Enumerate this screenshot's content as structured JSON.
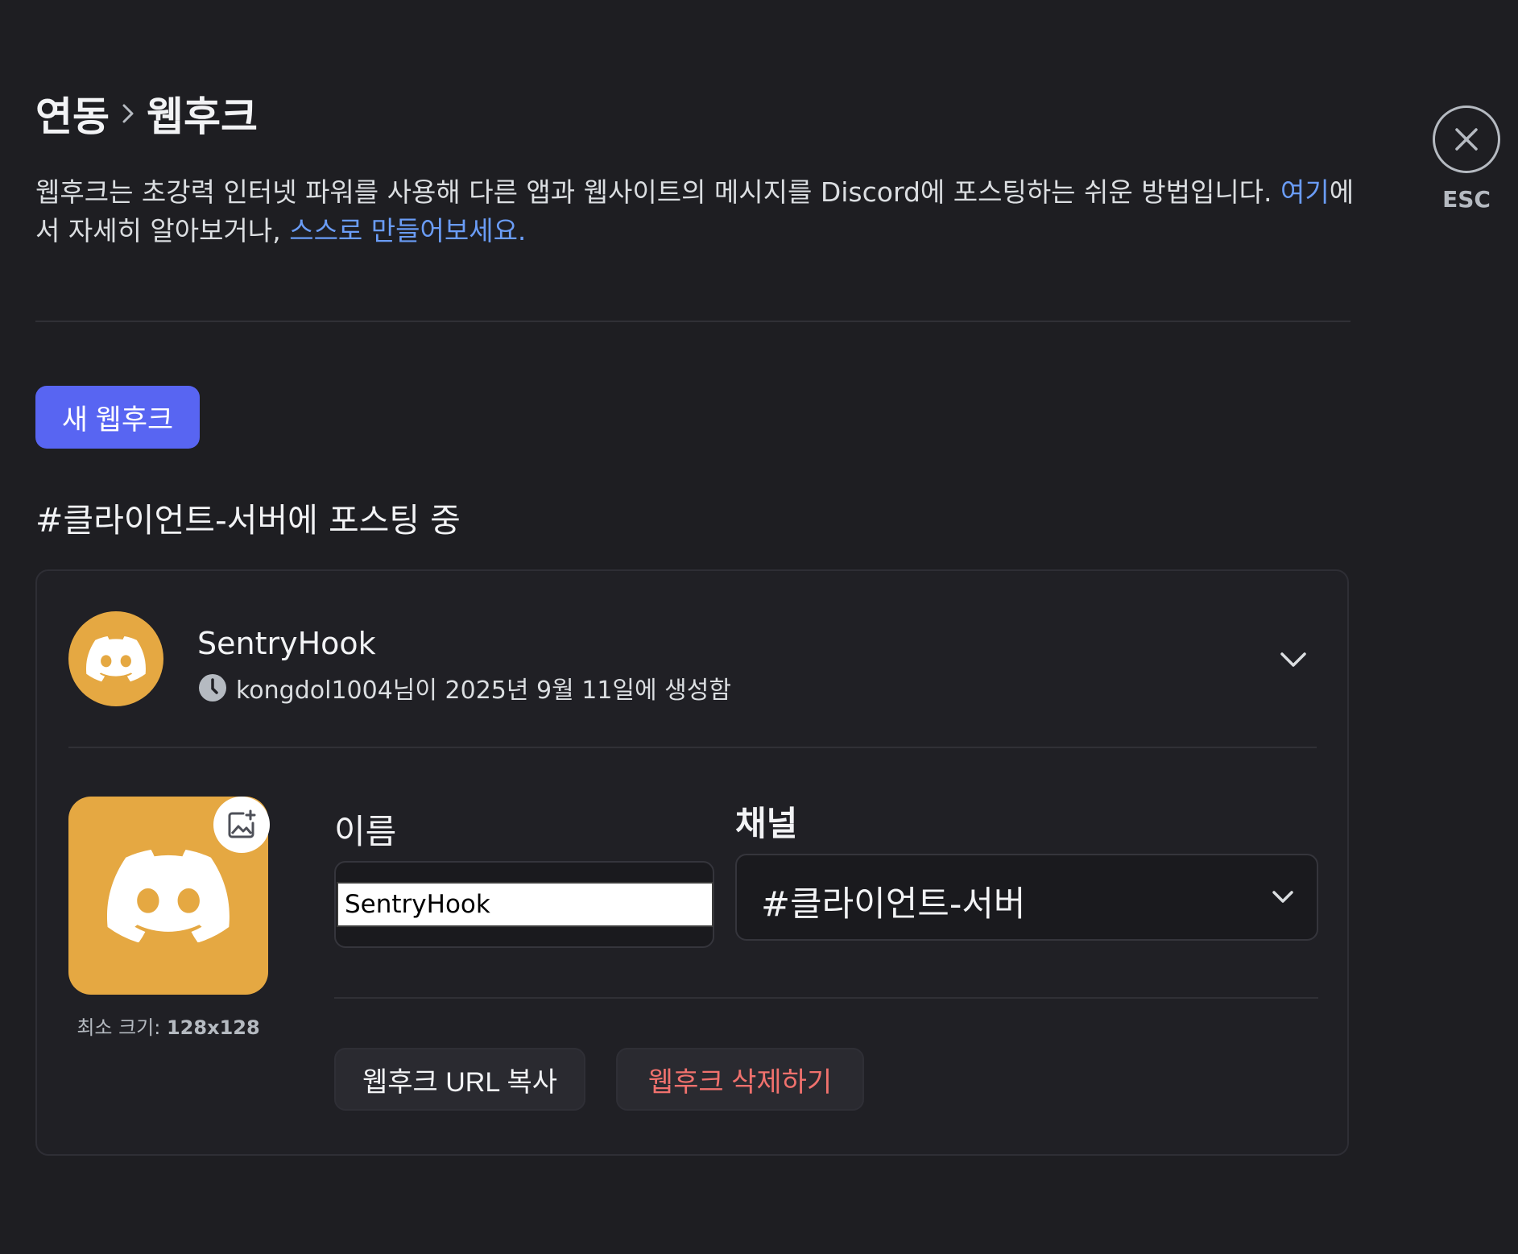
{
  "breadcrumb": {
    "parent": "연동",
    "current": "웹후크"
  },
  "description": {
    "text_before": "웹후크는 초강력 인터넷 파워를 사용해 다른 앱과 웹사이트의 메시지를 Discord에 포스팅하는 쉬운 방법입니다. ",
    "link_here": "여기",
    "text_middle": "에서 자세히 알아보거나, ",
    "link_build": "스스로 만들어보세요."
  },
  "new_webhook_label": "새 웹후크",
  "posting_title": "#클라이언트-서버에 포스팅 중",
  "webhook": {
    "name": "SentryHook",
    "created_meta": "kongdol1004님이 2025년 9월 11일에 생성함",
    "min_size_label": "최소 크기: ",
    "min_size_value": "128x128",
    "name_label": "이름",
    "name_value": "SentryHook",
    "channel_label": "채널",
    "channel_value": "#클라이언트-서버",
    "copy_url_label": "웹후크 URL 복사",
    "delete_label": "웹후크 삭제하기"
  },
  "close": {
    "esc_label": "ESC"
  },
  "colors": {
    "accent": "#5865f2",
    "avatar_bg": "#e5a842",
    "link": "#6a9cf6",
    "danger": "#f0716d"
  },
  "icons": {
    "breadcrumb_separator": "chevron-right-icon",
    "avatar": "discord-logo-icon",
    "created": "clock-icon",
    "expand": "chevron-down-icon",
    "upload": "image-add-icon",
    "channel_dropdown": "chevron-down-icon",
    "close": "close-icon"
  }
}
